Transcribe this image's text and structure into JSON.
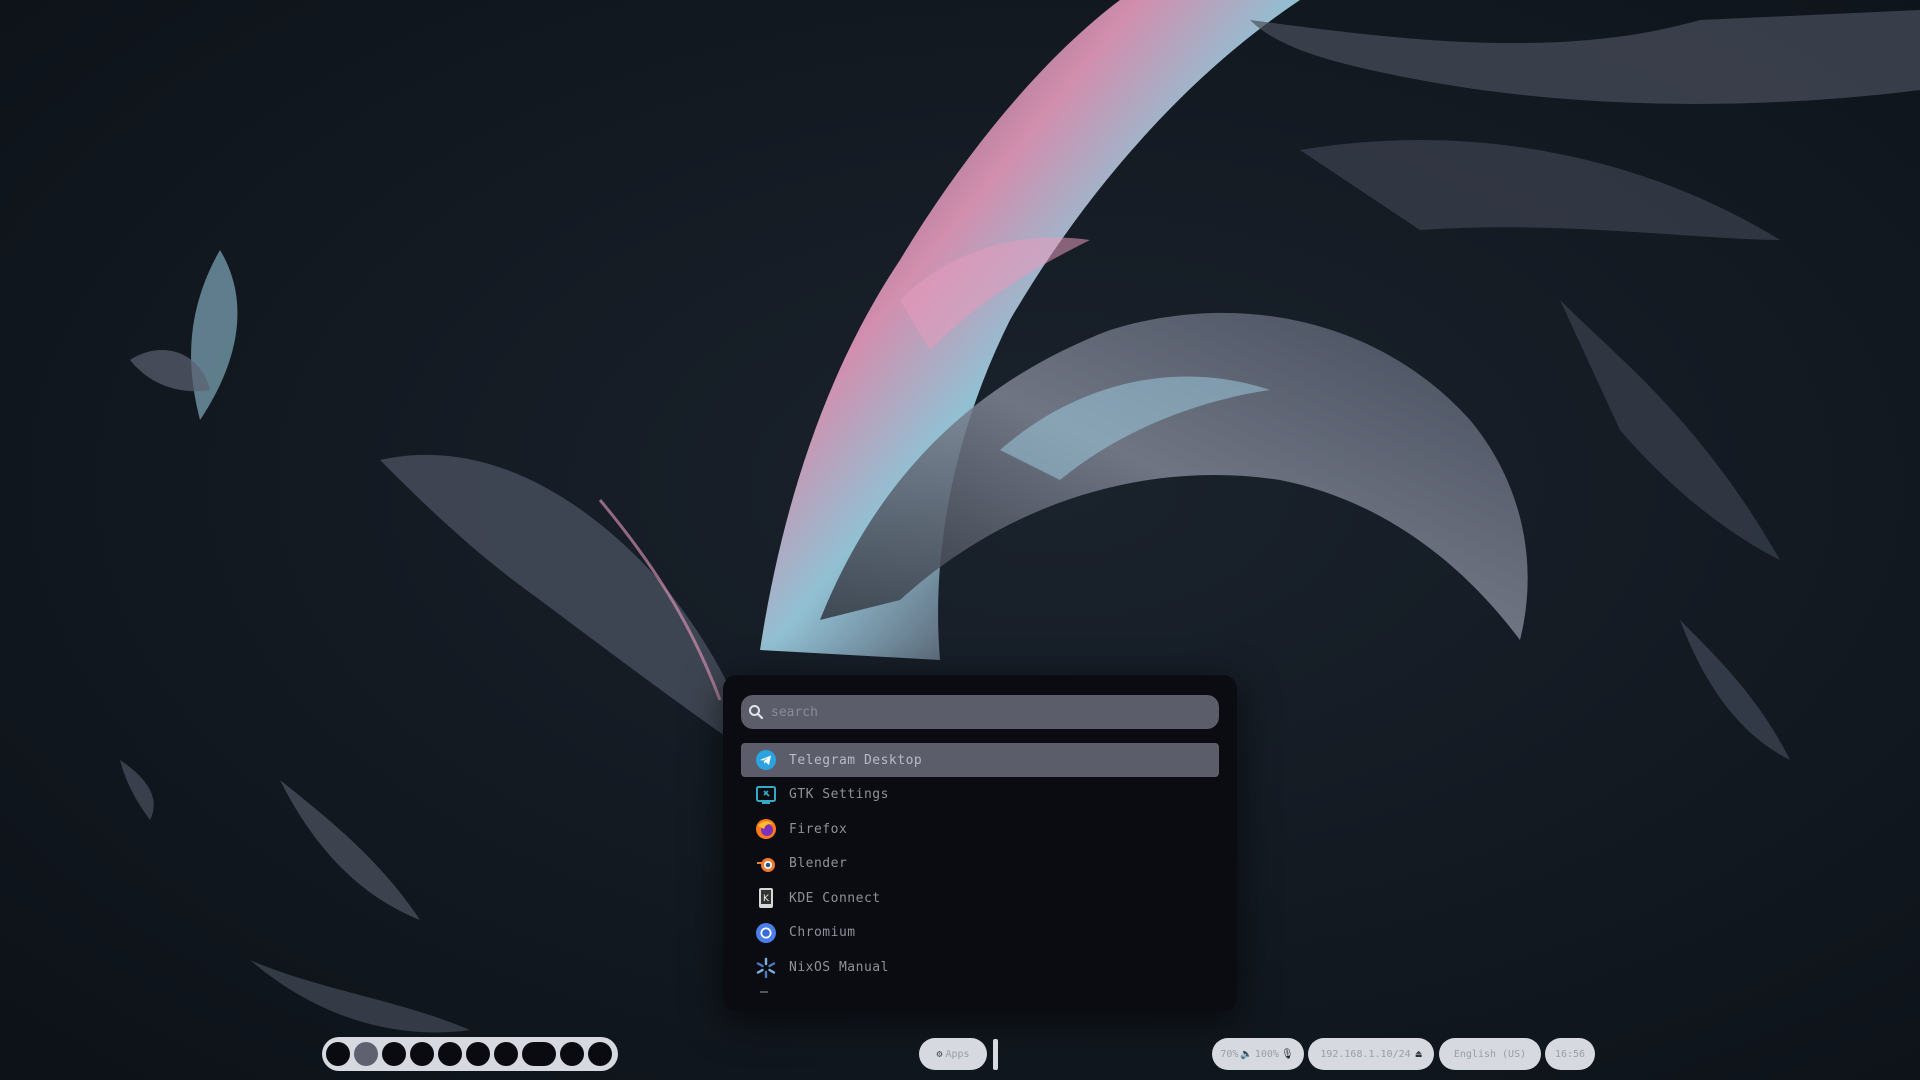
{
  "launcher": {
    "search_placeholder": "search",
    "apps": [
      {
        "label": "Telegram Desktop",
        "icon": "telegram-icon",
        "selected": true
      },
      {
        "label": "GTK Settings",
        "icon": "gtk-settings-icon",
        "selected": false
      },
      {
        "label": "Firefox",
        "icon": "firefox-icon",
        "selected": false
      },
      {
        "label": "Blender",
        "icon": "blender-icon",
        "selected": false
      },
      {
        "label": "KDE Connect",
        "icon": "kde-connect-icon",
        "selected": false
      },
      {
        "label": "Chromium",
        "icon": "chromium-icon",
        "selected": false
      },
      {
        "label": "NixOS Manual",
        "icon": "nixos-icon",
        "selected": false
      }
    ]
  },
  "taskbar": {
    "workspace_count": 10,
    "active_workspace": 2,
    "apps_label": "Apps",
    "volume": "70%",
    "mic": "100%",
    "network": "192.168.1.10/24",
    "language": "English (US)",
    "clock": "16:56"
  },
  "colors": {
    "panel_bg": "#0b0c11",
    "selection": "#5c5d6b",
    "pill_bg": "#d7d9e0"
  }
}
